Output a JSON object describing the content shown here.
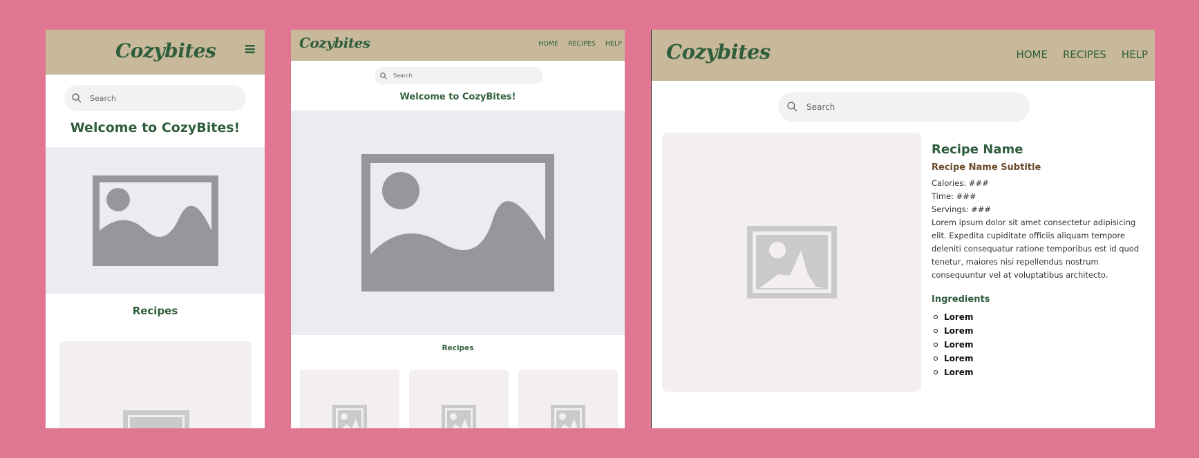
{
  "brand": {
    "logo": "Cozybites",
    "brand_color": "#2f5e3c",
    "header_color": "#c8b99b",
    "background_color": "#e07692"
  },
  "nav": {
    "home": "HOME",
    "recipes": "RECIPES",
    "help": "HELP",
    "menu_icon": "hamburger-icon"
  },
  "search": {
    "placeholder": "Search",
    "icon": "search-icon"
  },
  "home": {
    "welcome": "Welcome to CozyBites!",
    "recipes_title": "Recipes"
  },
  "recipe": {
    "name": "Recipe Name",
    "subtitle": "Recipe Name Subtitle",
    "calories": "Calories: ###",
    "time": "Time: ###",
    "servings": "Servings: ###",
    "description": "Lorem ipsum dolor sit amet consectetur adipisicing elit. Expedita cupiditate officiis aliquam tempore deleniti consequatur ratione temporibus est id quod tenetur, maiores nisi repellendus nostrum consequuntur vel at voluptatibus architecto.",
    "ingredients_title": "Ingredients",
    "ingredients": [
      "Lorem",
      "Lorem",
      "Lorem",
      "Lorem",
      "Lorem"
    ]
  }
}
